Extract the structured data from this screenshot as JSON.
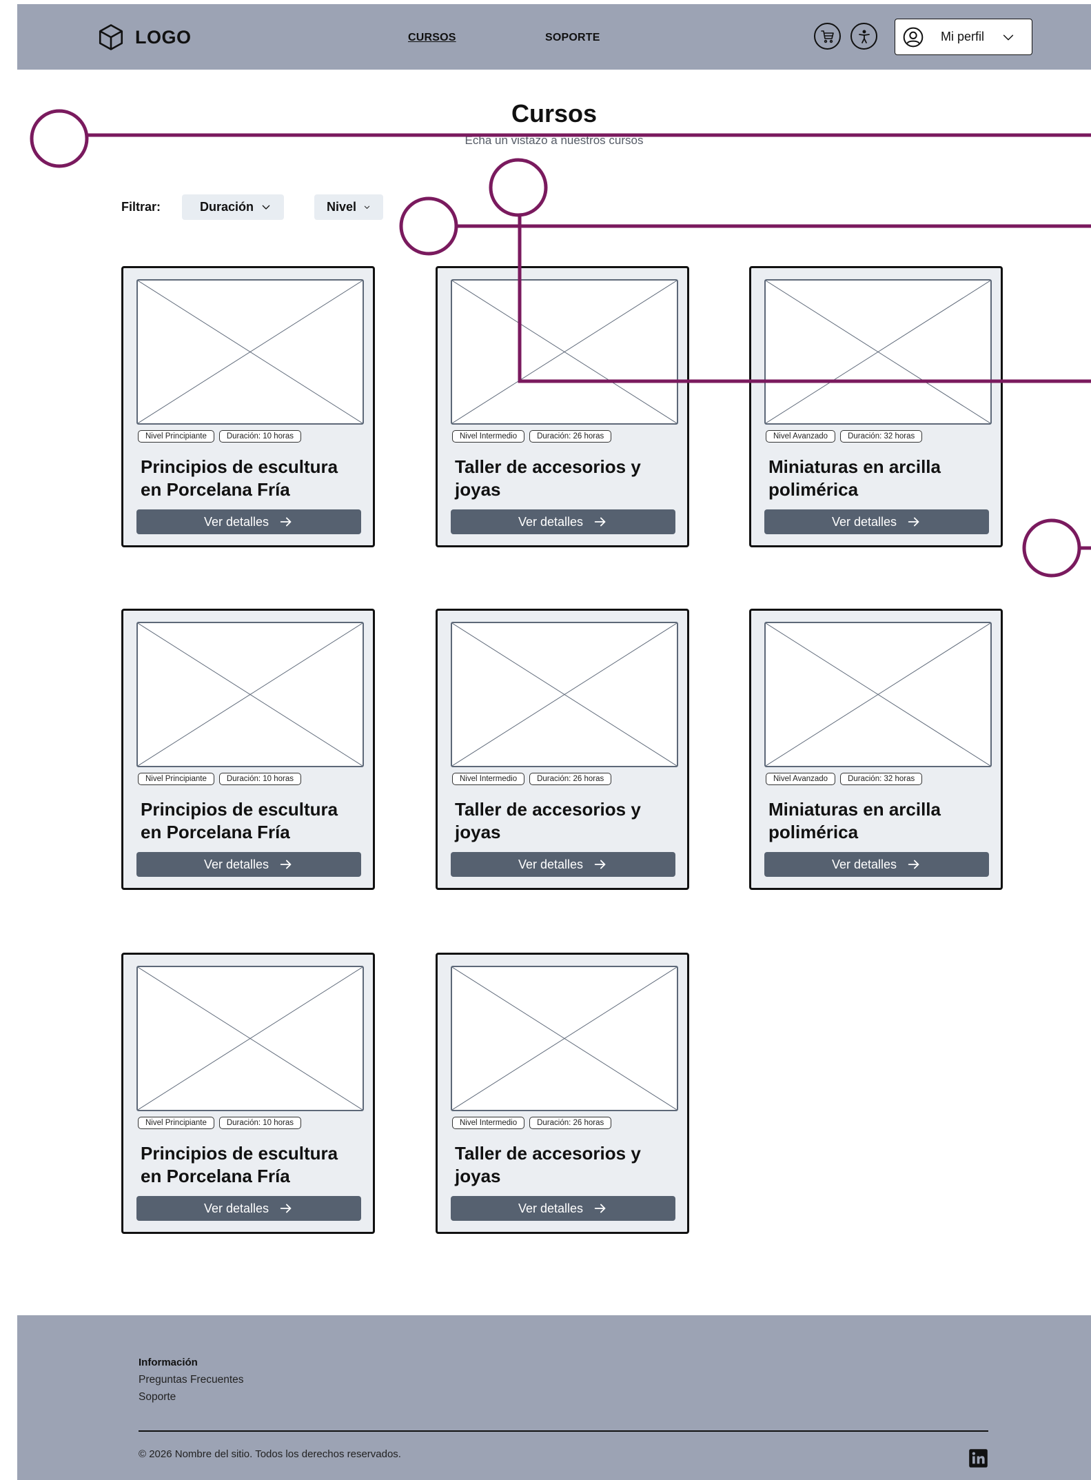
{
  "header": {
    "logo_text": "LOGO",
    "nav": {
      "cursos": "CURSOS",
      "soporte": "SOPORTE"
    },
    "profile_label": "Mi perfil",
    "bg_color": "#9ca3b4"
  },
  "main": {
    "title": "Cursos",
    "subtitle": "Echa un vistazo a nuestros cursos"
  },
  "filters": {
    "label": "Filtrar:",
    "duracion": "Duración",
    "nivel": "Nivel"
  },
  "courses": [
    {
      "level": "Nivel Principiante",
      "duration": "Duración: 10 horas",
      "title": "Principios de escultura en Porcelana Fría",
      "button": "Ver detalles"
    },
    {
      "level": "Nivel Intermedio",
      "duration": "Duración: 26 horas",
      "title": "Taller de accesorios y joyas",
      "button": "Ver detalles"
    },
    {
      "level": "Nivel Avanzado",
      "duration": "Duración: 32 horas",
      "title": "Miniaturas en arcilla polimérica",
      "button": "Ver detalles"
    },
    {
      "level": "Nivel Principiante",
      "duration": "Duración: 10 horas",
      "title": "Principios de escultura en Porcelana Fría",
      "button": "Ver detalles"
    },
    {
      "level": "Nivel Intermedio",
      "duration": "Duración: 26 horas",
      "title": "Taller de accesorios y joyas",
      "button": "Ver detalles"
    },
    {
      "level": "Nivel Avanzado",
      "duration": "Duración: 32 horas",
      "title": "Miniaturas en arcilla polimérica",
      "button": "Ver detalles"
    },
    {
      "level": "Nivel Principiante",
      "duration": "Duración: 10 horas",
      "title": "Principios de escultura en Porcelana Fría",
      "button": "Ver detalles"
    },
    {
      "level": "Nivel Intermedio",
      "duration": "Duración: 26 horas",
      "title": "Taller de accesorios y joyas",
      "button": "Ver detalles"
    }
  ],
  "footer": {
    "heading": "Información",
    "links": [
      "Preguntas Frecuentes",
      "Soporte"
    ],
    "copyright": "© 2026 Nombre del sitio. Todos los derechos reservados.",
    "social_icon": "linkedin-icon"
  },
  "colors": {
    "annotation": "#7a1a5e",
    "button": "#566170",
    "card_bg": "#ebeef2"
  }
}
